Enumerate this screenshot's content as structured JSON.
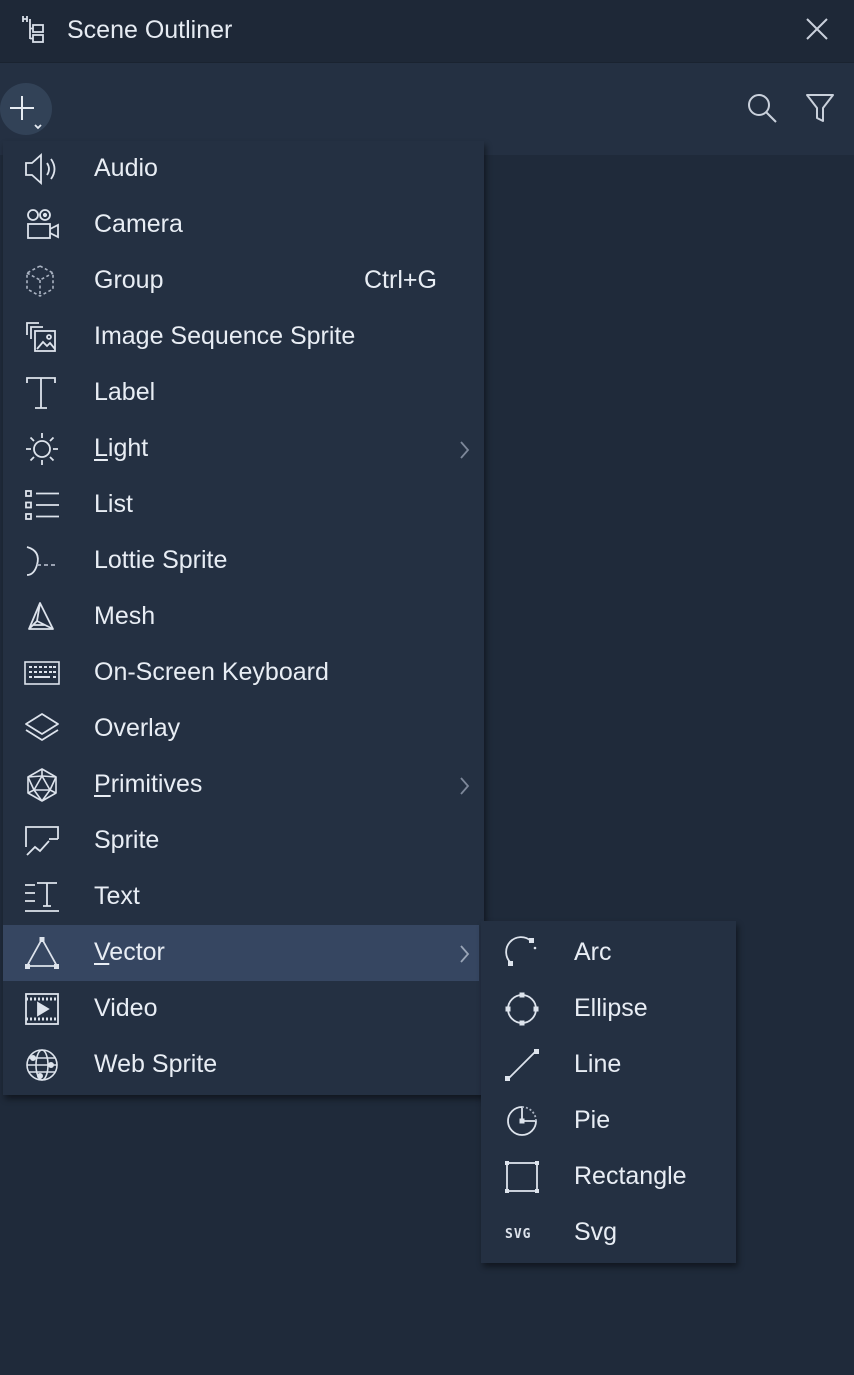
{
  "window": {
    "title": "Scene Outliner",
    "title_icon": "outliner-tree-icon",
    "close_icon": "close-icon"
  },
  "toolbar": {
    "add_icon": "plus-dropdown-icon",
    "search_icon": "search-icon",
    "filter_icon": "filter-icon"
  },
  "menu": {
    "items": [
      {
        "label": "Audio",
        "icon": "audio-icon"
      },
      {
        "label": "Camera",
        "icon": "camera-icon"
      },
      {
        "label": "Group",
        "icon": "group-icon",
        "shortcut": "Ctrl+G"
      },
      {
        "label": "Image Sequence Sprite",
        "icon": "image-sequence-icon"
      },
      {
        "label": "Label",
        "icon": "label-icon"
      },
      {
        "label": "Light",
        "icon": "light-icon",
        "mnemonic": "L",
        "rest": "ight",
        "submenu": true
      },
      {
        "label": "List",
        "icon": "list-icon"
      },
      {
        "label": "Lottie Sprite",
        "icon": "lottie-icon"
      },
      {
        "label": "Mesh",
        "icon": "mesh-icon"
      },
      {
        "label": "On-Screen Keyboard",
        "icon": "keyboard-icon"
      },
      {
        "label": "Overlay",
        "icon": "overlay-icon"
      },
      {
        "label": "Primitives",
        "icon": "primitives-icon",
        "mnemonic": "P",
        "rest": "rimitives",
        "submenu": true
      },
      {
        "label": "Sprite",
        "icon": "sprite-icon"
      },
      {
        "label": "Text",
        "icon": "text-icon"
      },
      {
        "label": "Vector",
        "icon": "vector-icon",
        "mnemonic": "V",
        "rest": "ector",
        "submenu": true,
        "highlighted": true
      },
      {
        "label": "Video",
        "icon": "video-icon"
      },
      {
        "label": "Web Sprite",
        "icon": "web-sprite-icon"
      }
    ]
  },
  "vector_submenu": {
    "items": [
      {
        "label": "Arc",
        "icon": "arc-icon"
      },
      {
        "label": "Ellipse",
        "icon": "ellipse-icon"
      },
      {
        "label": "Line",
        "icon": "line-icon"
      },
      {
        "label": "Pie",
        "icon": "pie-icon"
      },
      {
        "label": "Rectangle",
        "icon": "rectangle-icon"
      },
      {
        "label": "Svg",
        "icon": "svg-icon",
        "glyph": "SVG"
      }
    ]
  },
  "colors": {
    "background": "#1f2a3a",
    "panel": "#243042",
    "highlight": "#364661",
    "text": "#e8edf4"
  }
}
